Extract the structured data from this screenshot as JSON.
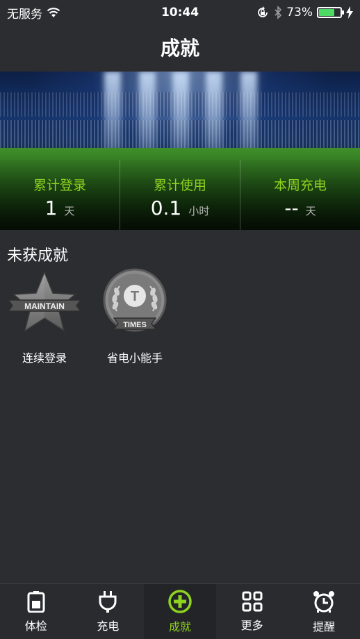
{
  "status_bar": {
    "carrier": "无服务",
    "time": "10:44",
    "battery_percent": "73%",
    "battery_level": 0.73
  },
  "header": {
    "title": "成就"
  },
  "stats": [
    {
      "label": "累计登录",
      "value": "1",
      "unit": "天"
    },
    {
      "label": "累计使用",
      "value": "0.1",
      "unit": "小时"
    },
    {
      "label": "本周充电",
      "value": "--",
      "unit": "天"
    }
  ],
  "section": {
    "title": "未获成就"
  },
  "achievements": [
    {
      "label": "连续登录",
      "badge_text": "MAINTAIN",
      "icon": "star-badge-icon"
    },
    {
      "label": "省电小能手",
      "badge_text": "TIMES",
      "badge_letter": "T",
      "icon": "laurel-badge-icon"
    }
  ],
  "tabs": [
    {
      "label": "体检",
      "icon": "battery-icon"
    },
    {
      "label": "充电",
      "icon": "plug-icon"
    },
    {
      "label": "成就",
      "icon": "plus-circle-icon",
      "active": true
    },
    {
      "label": "更多",
      "icon": "grid-icon"
    },
    {
      "label": "提醒",
      "icon": "alarm-clock-icon"
    }
  ],
  "colors": {
    "accent": "#8ed31f",
    "background": "#2c2d31",
    "battery": "#4cd964"
  }
}
